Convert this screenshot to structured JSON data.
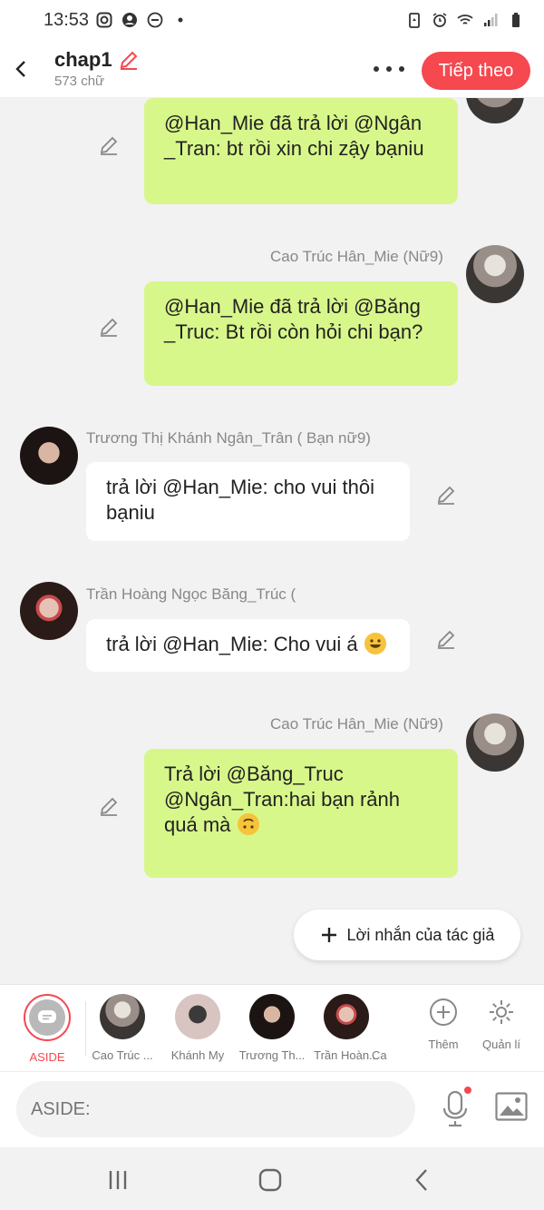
{
  "status_bar": {
    "time": "13:53",
    "icons": [
      "instagram-icon",
      "account-icon",
      "dnd-icon",
      "dot-icon",
      "battery-saver-icon",
      "alarm-icon",
      "wifi-icon",
      "signal-icon",
      "battery-icon"
    ]
  },
  "header": {
    "title": "chap1",
    "word_count": "573 chữ",
    "next_label": "Tiếp theo"
  },
  "messages": [
    {
      "side": "right",
      "sender": "",
      "text": "@Han_Mie đã trả lời @Ngân _Tran: bt rồi xin chi zậy bạniu"
    },
    {
      "side": "right",
      "sender": "Cao Trúc Hân_Mie (Nữ9)",
      "text": "@Han_Mie đã trả lời @Băng _Truc: Bt rồi còn hỏi chi bạn?"
    },
    {
      "side": "left",
      "sender": "Trương Thị Khánh Ngân_Trân ( Bạn nữ9)",
      "text": "trả lời @Han_Mie: cho vui thôi bạniu"
    },
    {
      "side": "left",
      "sender": "Trần Hoàng Ngọc Băng_Trúc (",
      "text": "trả lời @Han_Mie: Cho vui á"
    },
    {
      "side": "right",
      "sender": "Cao Trúc Hân_Mie (Nữ9)",
      "text": "Trả lời @Băng_Truc @Ngân_Tran:hai bạn rảnh quá mà"
    }
  ],
  "author_note_label": "Lời nhắn của tác giả",
  "characters": {
    "aside_label": "ASIDE",
    "items": [
      {
        "name": "Cao Trúc ..."
      },
      {
        "name": "Khánh My"
      },
      {
        "name": "Trương Th..."
      },
      {
        "name": "Trần Hoàn..."
      },
      {
        "name": "Ca"
      }
    ],
    "add_label": "Thêm",
    "manage_label": "Quản lí"
  },
  "input": {
    "placeholder": "ASIDE:"
  },
  "colors": {
    "accent": "#f5484f",
    "bubble_green": "#d8f78a",
    "bubble_white": "#ffffff",
    "background": "#f2f2f2"
  }
}
